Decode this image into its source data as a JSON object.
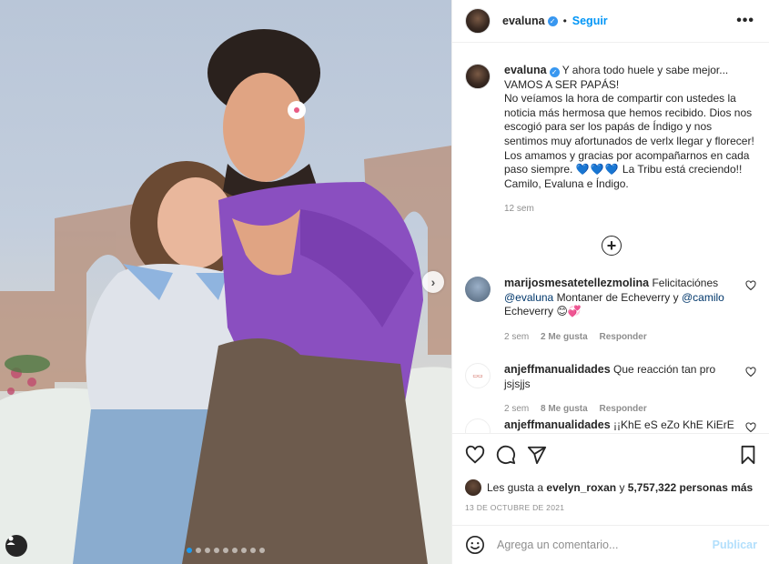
{
  "post": {
    "images_count": 9,
    "current_image": 1,
    "next_icon": "chevron-right-icon",
    "user_tag_icon": "user-tag-icon"
  },
  "header": {
    "username": "evaluna",
    "verified_icon": "verified-badge-icon",
    "separator": "•",
    "follow_label": "Seguir",
    "more_icon": "more-options-icon"
  },
  "caption": {
    "username": "evaluna",
    "line1": "Y ahora todo huele y sabe mejor...",
    "line2": "VAMOS A SER PAPÁS!",
    "body": "No veíamos la hora de compartir con ustedes la noticia más hermosa que hemos recibido. Dios nos escogió para ser los papás de Índigo y nos sentimos muy afortunados de verlx llegar y florecer! Los amamos y gracias por acompañarnos en cada paso siempre.",
    "hearts": "💙💙💙",
    "tribe": "La Tribu está creciendo!!",
    "signature": "Camilo, Evaluna e Índigo.",
    "time": "12 sem"
  },
  "load_more_icon": "plus-circle-icon",
  "comments": [
    {
      "username": "marijosmesatetellezmolina",
      "text_pre": "Felicitaciónes",
      "mention1": "@evaluna",
      "text_mid": "Montaner de Echeverry y",
      "mention2": "@camilo",
      "text_post": "Echeverry 😊💞",
      "time": "2 sem",
      "likes": "2 Me gusta",
      "reply": "Responder"
    },
    {
      "username": "anjeffmanualidades",
      "text": "Que reacción tan pro jsjsjjs",
      "time": "2 sem",
      "likes": "8 Me gusta",
      "reply": "Responder"
    },
    {
      "username": "anjeffmanualidades",
      "text": "¡¡KhE eS eZo KhE KiErE"
    }
  ],
  "actions": {
    "like_icon": "heart-icon",
    "comment_icon": "comment-icon",
    "share_icon": "share-icon",
    "save_icon": "bookmark-icon",
    "likes_prefix": "Les gusta a",
    "likes_user": "evelyn_roxan",
    "likes_conj": "y",
    "likes_count": "5,757,322 personas más",
    "date": "13 DE OCTUBRE DE 2021"
  },
  "add_comment": {
    "emoji_icon": "emoji-icon",
    "placeholder": "Agrega un comentario...",
    "publish_label": "Publicar"
  },
  "colors": {
    "accent": "#0095f6",
    "mention": "#00376b",
    "muted": "#8e8e8e",
    "publish_disabled": "#b2dffc"
  }
}
